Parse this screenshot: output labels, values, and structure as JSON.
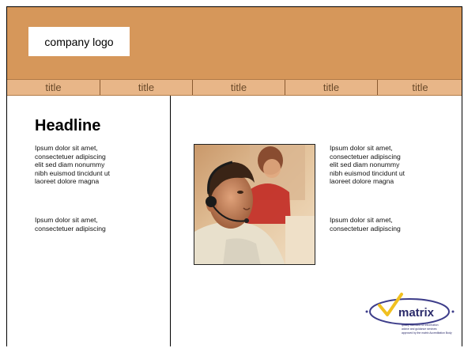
{
  "header": {
    "logo_text": "company logo",
    "brand_color": "#d6975a",
    "nav_color": "#e8b688"
  },
  "nav": {
    "items": [
      {
        "label": "title"
      },
      {
        "label": "title"
      },
      {
        "label": "title"
      },
      {
        "label": "title"
      },
      {
        "label": "title"
      }
    ]
  },
  "left_column": {
    "headline": "Headline",
    "paragraph_1": "Ipsum dolor sit amet,\nconsectetuer adipiscing\nelit sed diam nonummy\nnibh euismod tincidunt ut\nlaoreet dolore magna",
    "paragraph_2": "Ipsum dolor sit amet,\nconsectetuer adipiscing"
  },
  "right_column": {
    "paragraph_1": "Ipsum dolor sit amet,\nconsectetuer adipiscing\nelit sed diam nonummy\nnibh euismod tincidunt ut\nlaoreet dolore magna",
    "paragraph_2": "Ipsum dolor sit amet,\nconsectetuer adipiscing",
    "photo_icon": "call-center-agent-photo",
    "badge": {
      "name": "matrix",
      "tagline_1": "quality standard for information",
      "tagline_2": "advice and guidance services",
      "tagline_3": "approved by the matrix Accreditation Body"
    }
  }
}
